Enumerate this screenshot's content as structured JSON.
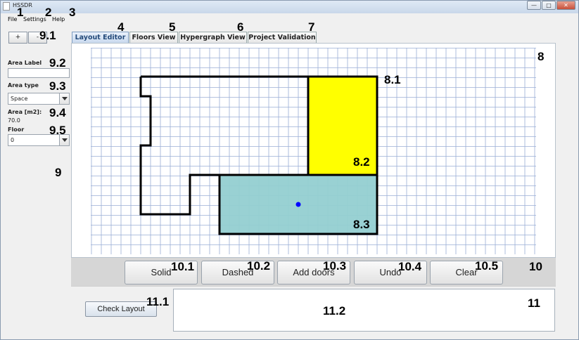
{
  "window": {
    "title": "HSSDR",
    "minimize": "—",
    "maximize": "□",
    "close": "✕"
  },
  "menu": {
    "file": "File",
    "settings": "Settings",
    "help": "Help"
  },
  "tabs": [
    {
      "label": "Layout Editor",
      "active": true
    },
    {
      "label": "Floors View",
      "active": false
    },
    {
      "label": "Hypergraph View",
      "active": false
    },
    {
      "label": "Project Validation",
      "active": false
    }
  ],
  "sidebar": {
    "zoom_in": "+",
    "zoom_out": "-",
    "area_label_title": "Area Label",
    "area_label_value": "",
    "area_type_title": "Area type",
    "area_type_value": "Space",
    "area_m2_title": "Area [m2]:",
    "area_m2_value": "70.0",
    "floor_title": "Floor",
    "floor_value": "0"
  },
  "toolbar": {
    "solid": "Solid",
    "dashed": "Dashed",
    "add_doors": "Add doors",
    "undo": "Undo",
    "clear": "Clear"
  },
  "bottom": {
    "check_layout": "Check Layout",
    "result_text": ""
  },
  "annotations": {
    "a1": "1",
    "a2": "2",
    "a3": "3",
    "a4": "4",
    "a5": "5",
    "a6": "6",
    "a7": "7",
    "a8": "8",
    "a8_1": "8.1",
    "a8_2": "8.2",
    "a8_3": "8.3",
    "a9": "9",
    "a9_1": "9.1",
    "a9_2": "9.2",
    "a9_3": "9.3",
    "a9_4": "9.4",
    "a9_5": "9.5",
    "a10": "10",
    "a10_1": "10.1",
    "a10_2": "10.2",
    "a10_3": "10.3",
    "a10_4": "10.4",
    "a10_5": "10.5",
    "a11": "11",
    "a11_1": "11.1",
    "a11_2": "11.2"
  },
  "colors": {
    "grid_line": "#9aaed6",
    "yellow_area": "#ffff00",
    "teal_area": "#93cfd1",
    "outline": "#000000",
    "selected_point": "#0000ff"
  },
  "canvas": {
    "grid_step_m": 1,
    "areas": [
      {
        "name": "outer-boundary",
        "type": "outline"
      },
      {
        "name": "yellow-area",
        "type": "filled"
      },
      {
        "name": "teal-area",
        "type": "filled",
        "selected": true
      }
    ]
  }
}
